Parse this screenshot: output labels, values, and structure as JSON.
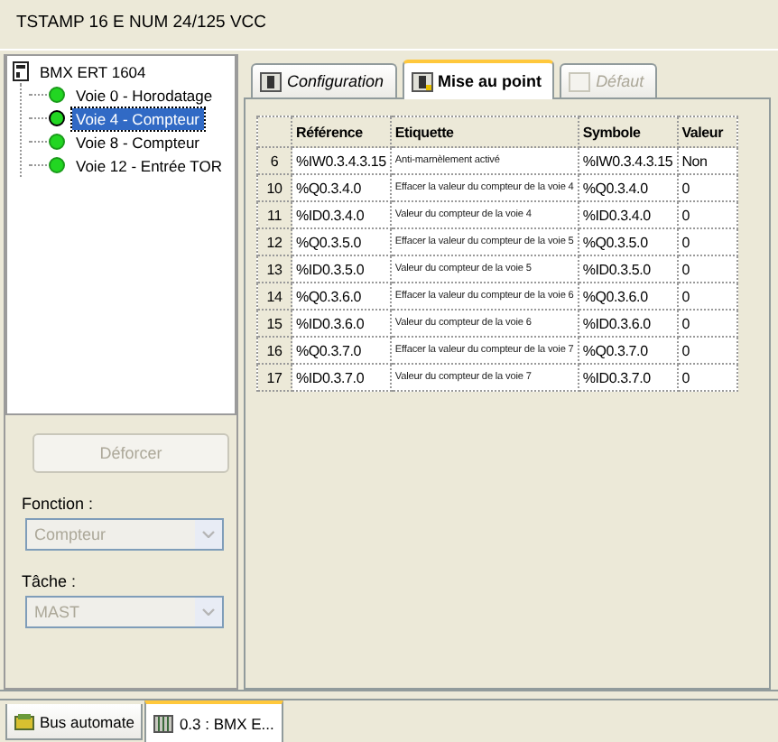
{
  "window": {
    "title": "TSTAMP 16 E NUM 24/125 VCC"
  },
  "tree": {
    "label": "BMX ERT 1604",
    "children": [
      {
        "label": "Voie 0 - Horodatage",
        "selected": false
      },
      {
        "label": "Voie 4 - Compteur",
        "selected": true
      },
      {
        "label": "Voie 8 - Compteur",
        "selected": false
      },
      {
        "label": "Voie 12 - Entrée TOR",
        "selected": false
      }
    ]
  },
  "unforce_button": {
    "label": "Déforcer",
    "disabled": true
  },
  "fields": [
    {
      "label": "Fonction :",
      "value": "Compteur",
      "disabled": true
    },
    {
      "label": "Tâche :",
      "value": "MAST",
      "disabled": true
    }
  ],
  "tabs": [
    {
      "label": "Configuration",
      "selected": false,
      "disabled": false
    },
    {
      "label": "Mise au point",
      "selected": true,
      "disabled": false
    },
    {
      "label": "Défaut",
      "selected": false,
      "disabled": true
    }
  ],
  "table": {
    "columns": [
      "Référence",
      "Etiquette",
      "Symbole",
      "Valeur"
    ],
    "rows": [
      {
        "index": "6",
        "reference": "%IW0.3.4.3.15",
        "label": "Anti-marnèlement activé",
        "symbol": "%IW0.3.4.3.15",
        "value": "Non"
      },
      {
        "index": "10",
        "reference": "%Q0.3.4.0",
        "label": "Effacer la valeur du compteur de la voie 4",
        "symbol": "%Q0.3.4.0",
        "value": "0"
      },
      {
        "index": "11",
        "reference": "%ID0.3.4.0",
        "label": "Valeur du compteur de la voie 4",
        "symbol": "%ID0.3.4.0",
        "value": "0"
      },
      {
        "index": "12",
        "reference": "%Q0.3.5.0",
        "label": "Effacer la valeur du compteur de la voie 5",
        "symbol": "%Q0.3.5.0",
        "value": "0"
      },
      {
        "index": "13",
        "reference": "%ID0.3.5.0",
        "label": "Valeur du compteur de la voie 5",
        "symbol": "%ID0.3.5.0",
        "value": "0"
      },
      {
        "index": "14",
        "reference": "%Q0.3.6.0",
        "label": "Effacer la valeur du compteur de la voie 6",
        "symbol": "%Q0.3.6.0",
        "value": "0"
      },
      {
        "index": "15",
        "reference": "%ID0.3.6.0",
        "label": "Valeur du compteur de la voie 6",
        "symbol": "%ID0.3.6.0",
        "value": "0"
      },
      {
        "index": "16",
        "reference": "%Q0.3.7.0",
        "label": "Effacer la valeur du compteur de la voie 7",
        "symbol": "%Q0.3.7.0",
        "value": "0"
      },
      {
        "index": "17",
        "reference": "%ID0.3.7.0",
        "label": "Valeur du compteur de la voie 7",
        "symbol": "%ID0.3.7.0",
        "value": "0"
      }
    ]
  },
  "bottom_tabs": [
    {
      "label": "Bus automate",
      "selected": false
    },
    {
      "label": "0.3 : BMX E...",
      "selected": true
    }
  ]
}
